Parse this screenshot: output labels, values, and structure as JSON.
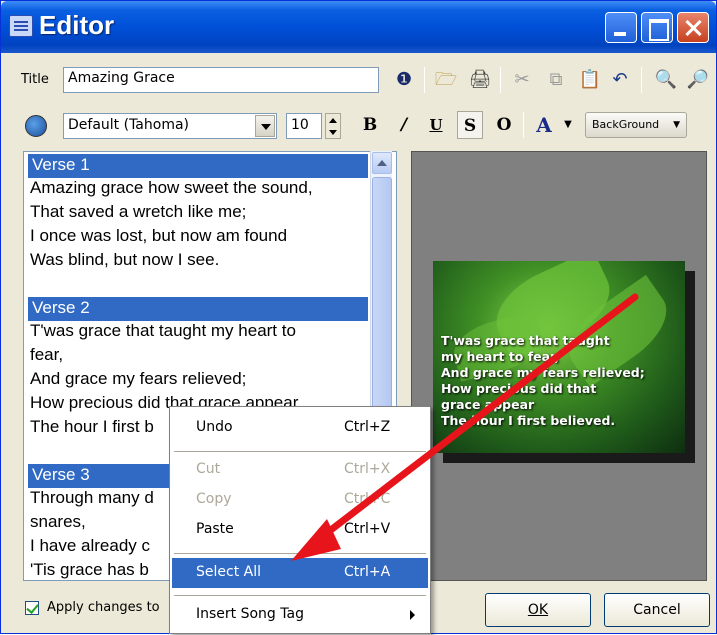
{
  "window": {
    "title": "Editor"
  },
  "toolbar": {
    "title_label": "Title",
    "title_value": "Amazing Grace",
    "font_value": "Default (Tahoma)",
    "font_size": "10",
    "bold_label": "B",
    "italic_label": "/",
    "underline_label": "U",
    "shadow_label": "S",
    "outline_label": "O",
    "font_color_label": "A",
    "background_label": "BackGround"
  },
  "editor": {
    "lines": [
      {
        "type": "verse",
        "text": "Verse 1"
      },
      {
        "type": "text",
        "text": "Amazing grace how sweet the sound,"
      },
      {
        "type": "text",
        "text": "That saved a wretch like me;"
      },
      {
        "type": "text",
        "text": "I once was lost, but now am found"
      },
      {
        "type": "text",
        "text": "Was blind, but now I see."
      },
      {
        "type": "verse",
        "text": "Verse 2"
      },
      {
        "type": "text",
        "text": "T'was grace that taught my heart to"
      },
      {
        "type": "text",
        "text": "fear,"
      },
      {
        "type": "text",
        "text": "And grace my fears relieved;"
      },
      {
        "type": "text",
        "text": "How precious did that grace appear"
      },
      {
        "type": "text",
        "text": "The hour I first b"
      },
      {
        "type": "verse",
        "text": "Verse 3"
      },
      {
        "type": "text",
        "text": "Through many d"
      },
      {
        "type": "text",
        "text": "snares,"
      },
      {
        "type": "text",
        "text": "I have already c"
      },
      {
        "type": "text",
        "text": "'Tis grace has b"
      }
    ]
  },
  "preview": {
    "lines": [
      "T'was grace that taught",
      "my heart to fear,",
      "And grace my fears relieved;",
      "How precious did that",
      "grace appear",
      "The hour I first believed."
    ]
  },
  "context_menu": {
    "items": [
      {
        "label": "Undo",
        "shortcut": "Ctrl+Z",
        "disabled": false
      },
      {
        "label": "Cut",
        "shortcut": "Ctrl+X",
        "disabled": true
      },
      {
        "label": "Copy",
        "shortcut": "Ctrl+C",
        "disabled": true
      },
      {
        "label": "Paste",
        "shortcut": "Ctrl+V",
        "disabled": false
      },
      {
        "label": "Select All",
        "shortcut": "Ctrl+A",
        "disabled": false,
        "selected": true
      },
      {
        "label": "Insert Song Tag",
        "shortcut": "",
        "has_submenu": true
      }
    ]
  },
  "footer": {
    "apply_label": "Apply changes to",
    "ok_label": "OK",
    "cancel_label": "Cancel"
  },
  "colors": {
    "selection": "#316ac5",
    "annotation_arrow": "#e8141c",
    "titlebar": "#0050d8"
  }
}
